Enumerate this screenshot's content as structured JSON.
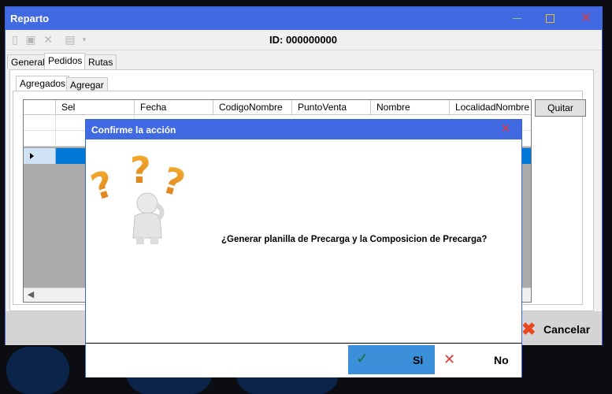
{
  "window": {
    "title": "Reparto",
    "id_label": "ID: 000000000"
  },
  "toolbar": {
    "icons": [
      "new-document-icon",
      "edit-document-icon",
      "delete-icon",
      "print-icon",
      "dropdown-arrow-icon"
    ]
  },
  "tabs": [
    {
      "label": "General"
    },
    {
      "label": "Pedidos"
    },
    {
      "label": "Rutas"
    }
  ],
  "subtabs": [
    {
      "label": "Agregados"
    },
    {
      "label": "Agregar"
    }
  ],
  "grid": {
    "columns": [
      {
        "label": "Sel"
      },
      {
        "label": "Fecha"
      },
      {
        "label": "CodigoNombre"
      },
      {
        "label": "PuntoVenta"
      },
      {
        "label": "Nombre"
      },
      {
        "label": "LocalidadNombre"
      }
    ]
  },
  "buttons": {
    "quitar": "Quitar",
    "cancelar": "Cancelar"
  },
  "dialog": {
    "title": "Confirme la acción",
    "message": "¿Generar planilla de Precarga y la Composicion de Precarga?",
    "yes_label": "Si",
    "no_label": "No"
  },
  "colors": {
    "titlebar": "#4169e1",
    "selected_row": "#0078d7",
    "yes_button": "#3a8fd8"
  }
}
